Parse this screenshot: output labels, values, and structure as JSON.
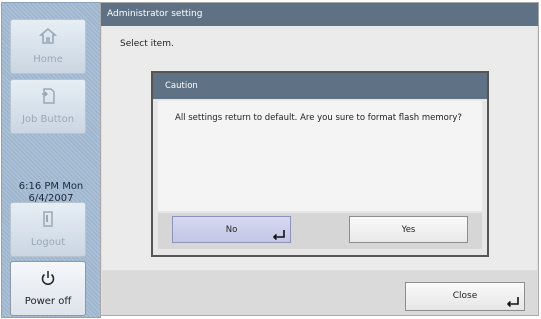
{
  "sidebar": {
    "home_label": "Home",
    "job_button_label": "Job Button",
    "clock_time": "6:16 PM  Mon",
    "clock_date": "6/4/2007",
    "logout_label": "Logout",
    "power_off_label": "Power off"
  },
  "main": {
    "title": "Administrator setting",
    "prompt": "Select item.",
    "close_label": "Close"
  },
  "dialog": {
    "title": "Caution",
    "message": "All settings return to default.  Are you sure to format flash memory?",
    "no_label": "No",
    "yes_label": "Yes"
  },
  "colors": {
    "titlebar": "#5f7184",
    "sidebar": "#9fb6cf",
    "selected_button": "#c9cbea"
  }
}
